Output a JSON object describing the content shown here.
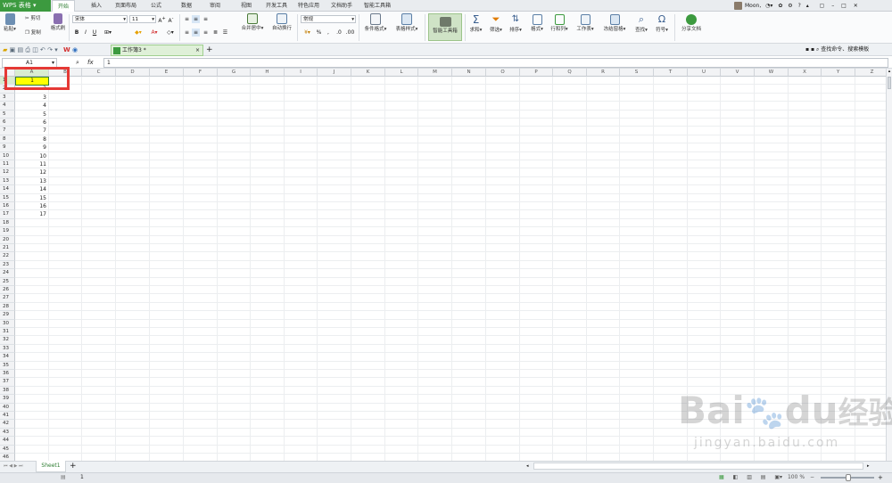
{
  "app": {
    "name": "WPS 表格"
  },
  "menu_tabs": [
    "开始",
    "插入",
    "页面布局",
    "公式",
    "数据",
    "审阅",
    "视图",
    "开发工具",
    "特色应用",
    "文档助手",
    "智能工具箱"
  ],
  "active_tab": "开始",
  "user": {
    "name": "Moon,"
  },
  "ribbon": {
    "paste": "粘贴",
    "cut": "剪切",
    "copy": "复制",
    "format_painter": "格式刷",
    "font_name": "宋体",
    "font_size": "11",
    "merge_center": "合并居中",
    "wrap_text": "自动换行",
    "number_format": "常规",
    "conditional_format": "条件格式",
    "table_style": "表格样式",
    "smart_toolbox": "智能工具箱",
    "sum": "求和",
    "filter": "筛选",
    "sort": "排序",
    "format": "格式",
    "row_col": "行和列",
    "worksheet": "工作表",
    "freeze": "冻结窗格",
    "find": "查找",
    "symbol": "符号",
    "share": "分享文档"
  },
  "quickbar": {
    "doc_tab": "工作簿3 *",
    "search": "查找命令、搜索模板"
  },
  "formula_bar": {
    "name_box": "A1",
    "fx": "fx",
    "value": "1"
  },
  "columns": [
    "A",
    "B",
    "C",
    "D",
    "E",
    "F",
    "G",
    "H",
    "I",
    "J",
    "K",
    "L",
    "M",
    "N",
    "O",
    "P",
    "Q",
    "R",
    "S",
    "T",
    "U",
    "V",
    "W",
    "X",
    "Y",
    "Z"
  ],
  "rows": [
    "1",
    "2",
    "3",
    "4",
    "5",
    "6",
    "7",
    "8",
    "9",
    "10",
    "11",
    "12",
    "13",
    "14",
    "15",
    "16",
    "17",
    "18",
    "19",
    "20",
    "21",
    "22",
    "23",
    "24",
    "25",
    "26",
    "27",
    "28",
    "29",
    "30",
    "31",
    "32",
    "33",
    "34",
    "35",
    "36",
    "37",
    "38",
    "39",
    "40",
    "41",
    "42",
    "43",
    "44",
    "45",
    "46"
  ],
  "column_a_values": [
    "1",
    "2",
    "3",
    "4",
    "5",
    "6",
    "7",
    "8",
    "9",
    "10",
    "11",
    "12",
    "13",
    "14",
    "15",
    "16",
    "17"
  ],
  "sheet_tabs": [
    "Sheet1"
  ],
  "status": {
    "value": "1",
    "zoom": "100 %"
  },
  "watermark": {
    "brand": "Bai",
    "brand2": "du",
    "cn": "经验",
    "url": "jingyan.baidu.com"
  },
  "colors": {
    "accent": "#3c9a3f",
    "highlight": "#ffff00",
    "annotation": "#e53935"
  }
}
